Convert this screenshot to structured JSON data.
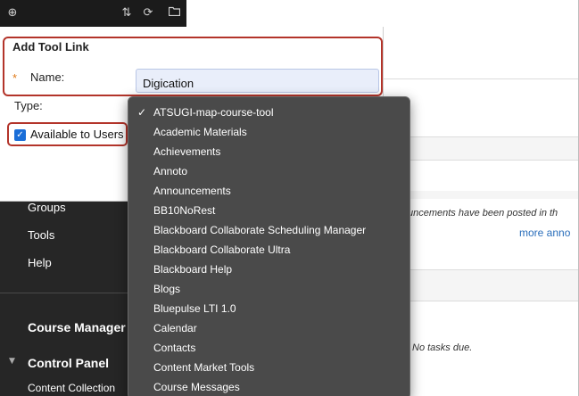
{
  "sidebar": {
    "top_icons": [
      "add-circle-icon",
      "sort-arrows-icon",
      "refresh-icon",
      "folder-icon"
    ],
    "nav_items": [
      "Groups",
      "Tools",
      "Help"
    ],
    "course_management_heading": "Course Manager",
    "control_panel_heading": "Control Panel",
    "content_collection": "Content Collection"
  },
  "form": {
    "title": "Add Tool Link",
    "required_marker": "*",
    "name_label": "Name:",
    "name_value": "Digication",
    "type_label": "Type:",
    "available_label": "Available to Users",
    "available_checked": true
  },
  "dropdown": {
    "selected": "ATSUGI-map-course-tool",
    "options": [
      "ATSUGI-map-course-tool",
      "Academic Materials",
      "Achievements",
      "Annoto",
      "Announcements",
      "BB10NoRest",
      "Blackboard Collaborate Scheduling Manager",
      "Blackboard Collaborate Ultra",
      "Blackboard Help",
      "Blogs",
      "Bluepulse LTI 1.0",
      "Calendar",
      "Contacts",
      "Content Market Tools",
      "Course Messages"
    ]
  },
  "content": {
    "announcements_text": "uncements have been posted in th",
    "more_link": "more anno",
    "tasks_text": "No tasks due."
  },
  "colors": {
    "sidebar_bg": "#262626",
    "highlight_border": "#b3342a",
    "dropdown_bg": "#4a4a4a",
    "link": "#2a6ebb",
    "required_star": "#e07b1a"
  }
}
